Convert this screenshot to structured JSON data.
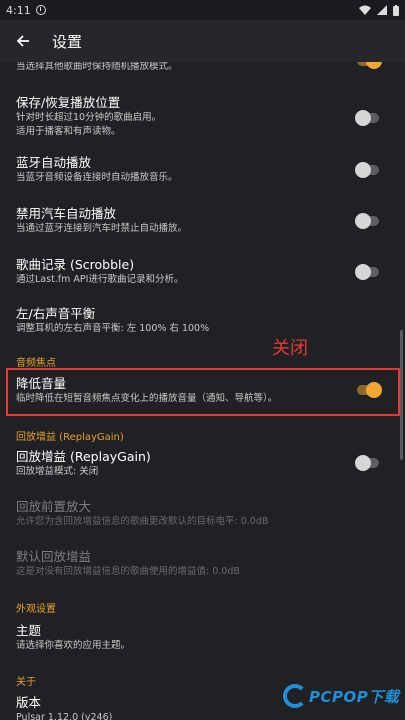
{
  "status_bar": {
    "time": "4:11"
  },
  "app_bar": {
    "title": "设置"
  },
  "items": [
    {
      "id": "shuffle",
      "sub": "当选择其他歌曲时保持随机播放模式。",
      "toggle": true
    },
    {
      "id": "resume",
      "title": "保存/恢复播放位置",
      "sub": "针对时长超过10分钟的歌曲启用。",
      "sub2": "适用于播客和有声读物。",
      "toggle": false
    },
    {
      "id": "bluetooth",
      "title": "蓝牙自动播放",
      "sub": "当蓝牙音频设备连接时自动播放音乐。",
      "toggle": false
    },
    {
      "id": "car",
      "title": "禁用汽车自动播放",
      "sub": "当通过蓝牙连接到汽车时禁止自动播放。",
      "toggle": false
    },
    {
      "id": "scrobble",
      "title": "歌曲记录 (Scrobble)",
      "sub": "通过Last.fm API进行歌曲记录和分析。",
      "toggle": false
    },
    {
      "id": "balance",
      "title": "左/右声音平衡",
      "sub": "调整耳机的左右声音平衡: 左 100% 右 100%"
    },
    {
      "id": "duck",
      "title": "降低音量",
      "sub": "临时降低在短暂音频焦点变化上的播放音量（通知、导航等）。",
      "toggle": true
    },
    {
      "id": "replaygain",
      "title": "回放增益 (ReplayGain)",
      "sub": "回放增益模式: 关闭",
      "toggle": false
    },
    {
      "id": "preamp",
      "title": "回放前置放大",
      "sub": "允许您为含回放增益信息的歌曲更改默认的目标电平: 0.0dB",
      "disabled": true
    },
    {
      "id": "default_gain",
      "title": "默认回放增益",
      "sub": "这是对没有回放增益信息的歌曲使用的增益值: 0.0dB",
      "disabled": true
    },
    {
      "id": "theme",
      "title": "主题",
      "sub": "请选择你喜欢的应用主题。"
    },
    {
      "id": "version",
      "title": "版本",
      "sub": "Pulsar 1.12.0 (v246)"
    }
  ],
  "sections": {
    "audio_focus": "音频焦点",
    "replaygain": "回放增益 (ReplayGain)",
    "appearance": "外观设置",
    "about": "关于"
  },
  "annotation": "关闭",
  "watermark": "PCPOP下载",
  "colors": {
    "accent": "#f3a634",
    "highlight": "#e53935",
    "background": "#202124"
  }
}
